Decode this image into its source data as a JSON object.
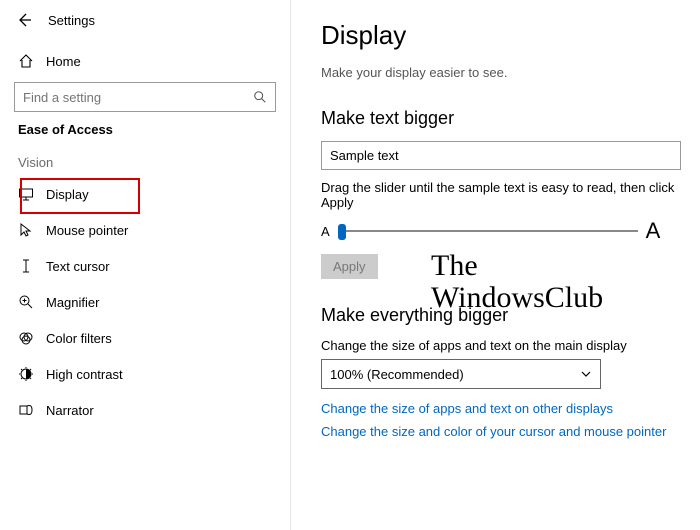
{
  "header": {
    "title": "Settings"
  },
  "sidebar": {
    "home": "Home",
    "search_placeholder": "Find a setting",
    "category": "Ease of Access",
    "group_vision": "Vision",
    "items": {
      "display": "Display",
      "mouse": "Mouse pointer",
      "textcursor": "Text cursor",
      "magnifier": "Magnifier",
      "colorfilters": "Color filters",
      "highcontrast": "High contrast",
      "narrator": "Narrator"
    }
  },
  "main": {
    "title": "Display",
    "subtitle": "Make your display easier to see.",
    "text_bigger": {
      "heading": "Make text bigger",
      "sample": "Sample text",
      "hint": "Drag the slider until the sample text is easy to read, then click Apply",
      "small_a": "A",
      "big_a": "A",
      "apply": "Apply"
    },
    "everything_bigger": {
      "heading": "Make everything bigger",
      "desc": "Change the size of apps and text on the main display",
      "dropdown_value": "100% (Recommended)",
      "link1": "Change the size of apps and text on other displays",
      "link2": "Change the size and color of your cursor and mouse pointer"
    }
  },
  "watermark": {
    "line1": "The",
    "line2": "WindowsClub"
  }
}
